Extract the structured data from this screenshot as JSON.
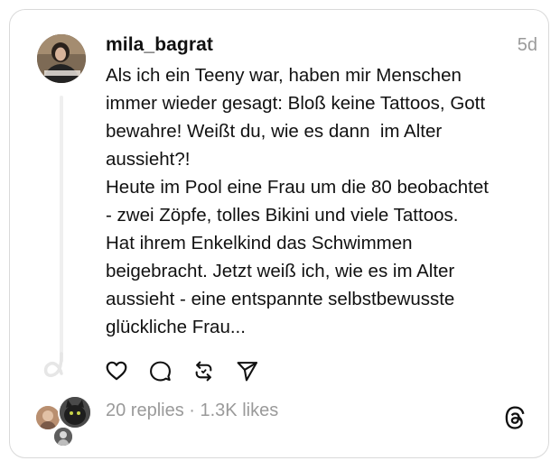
{
  "post": {
    "username": "mila_bagrat",
    "timestamp": "5d",
    "text_lines": [
      "Als ich ein Teeny war, haben mir Menschen",
      "immer wieder gesagt: Bloß keine Tattoos, Gott",
      "bewahre! Weißt du, wie es dann  im Alter",
      "aussieht?!",
      "Heute im Pool eine Frau um die 80 beobachtet",
      "- zwei Zöpfe, tolles Bikini und viele Tattoos.",
      "Hat ihrem Enkelkind das Schwimmen",
      "beigebracht. Jetzt weiß ich, wie es im Alter",
      "aussieht - eine entspannte selbstbewusste",
      "glückliche Frau..."
    ]
  },
  "actions": [
    {
      "name": "like",
      "icon": "heart-icon"
    },
    {
      "name": "reply",
      "icon": "speech-bubble-icon"
    },
    {
      "name": "repost",
      "icon": "repost-icon"
    },
    {
      "name": "share",
      "icon": "send-icon"
    }
  ],
  "stats": {
    "text": "20 replies · 1.3K likes"
  },
  "brand": {
    "icon": "threads-logo-icon"
  },
  "colors": {
    "text": "#111111",
    "muted": "#9a9a9a",
    "border": "#d9d9d9",
    "thread_line": "#efefef"
  }
}
